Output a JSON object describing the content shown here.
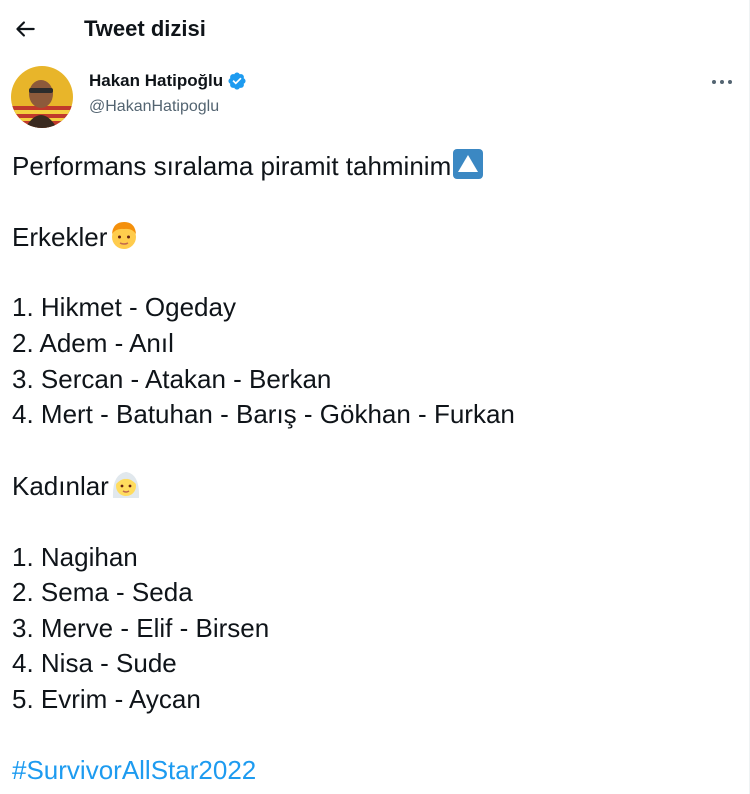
{
  "header": {
    "title": "Tweet dizisi",
    "back_icon": "arrow-left-icon"
  },
  "author": {
    "name": "Hakan Hatipoğlu",
    "handle": "@HakanHatipoglu",
    "verified": true,
    "verified_color": "#1d9bf0"
  },
  "tweet": {
    "intro": "Performans sıralama piramit tahminim",
    "intro_emoji": "up-arrow-button-icon",
    "men_heading": "Erkekler",
    "men_emoji": "man-blond-icon",
    "men": [
      "1. Hikmet - Ogeday",
      "2. Adem - Anıl",
      "3. Sercan - Atakan - Berkan",
      "4. Mert - Batuhan - Barış - Gökhan - Furkan"
    ],
    "women_heading": "Kadınlar",
    "women_emoji": "woman-white-hair-icon",
    "women": [
      "1. Nagihan",
      "2. Sema - Seda",
      "3. Merve - Elif - Birsen",
      "4. Nisa - Sude",
      "5. Evrim - Aycan"
    ],
    "hashtag": "#SurvivorAllStar2022",
    "hashtag_color": "#1d9bf0"
  }
}
